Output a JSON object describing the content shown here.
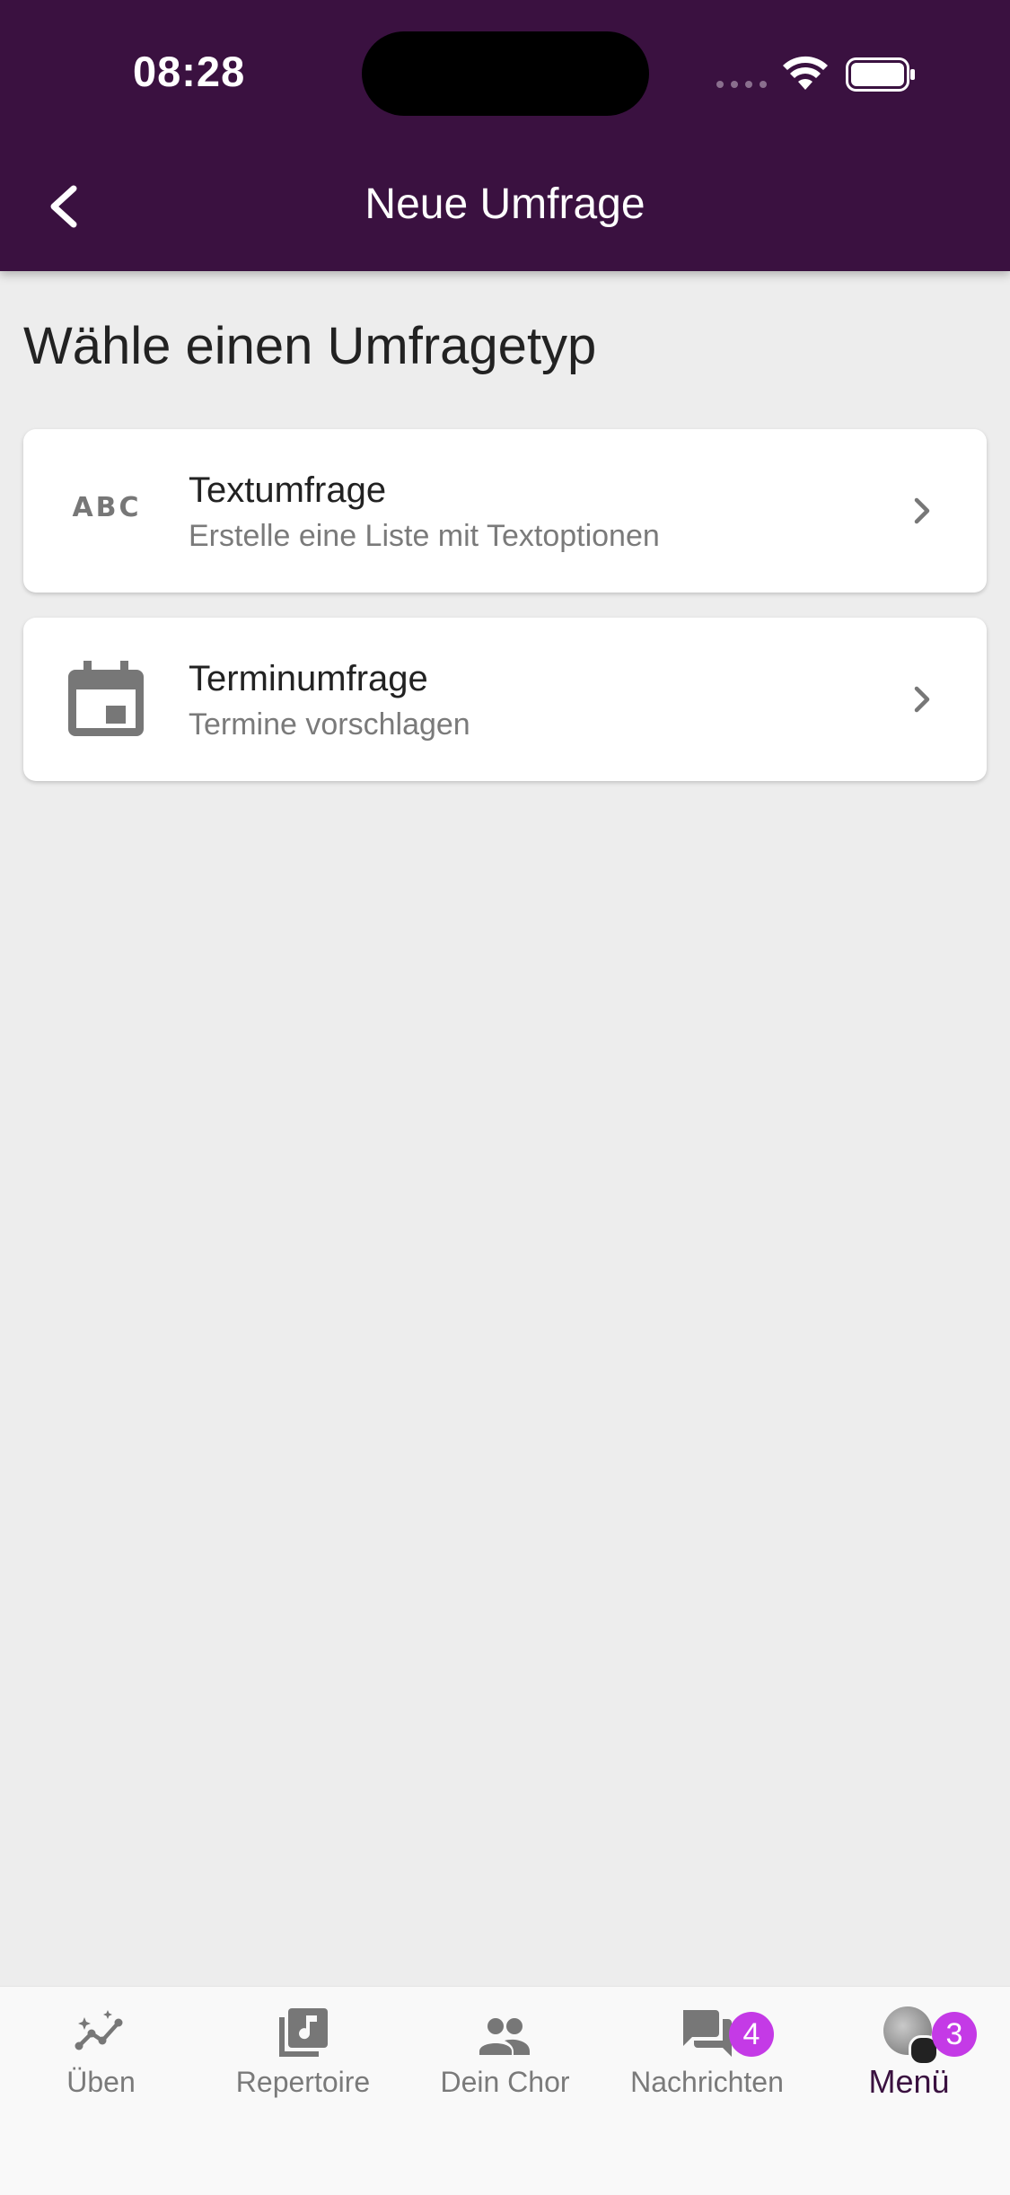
{
  "status_bar": {
    "time": "08:28"
  },
  "header": {
    "title": "Neue Umfrage",
    "back_icon": "chevron-left-icon"
  },
  "main": {
    "section_title": "Wähle einen Umfragetyp",
    "options": [
      {
        "icon": "abc-icon",
        "icon_text": "ABC",
        "title": "Textumfrage",
        "subtitle": "Erstelle eine Liste mit Textoptionen"
      },
      {
        "icon": "calendar-icon",
        "title": "Terminumfrage",
        "subtitle": "Termine vorschlagen"
      }
    ]
  },
  "bottom_nav": {
    "items": [
      {
        "label": "Üben",
        "icon": "practice-icon"
      },
      {
        "label": "Repertoire",
        "icon": "music-library-icon"
      },
      {
        "label": "Dein Chor",
        "icon": "group-icon"
      },
      {
        "label": "Nachrichten",
        "icon": "chat-icon",
        "badge": "4"
      },
      {
        "label": "Menü",
        "icon": "avatar",
        "badge": "3",
        "active": true
      }
    ]
  },
  "colors": {
    "header": "#3a1140",
    "badge": "#c43ae6",
    "background": "#ededed"
  }
}
